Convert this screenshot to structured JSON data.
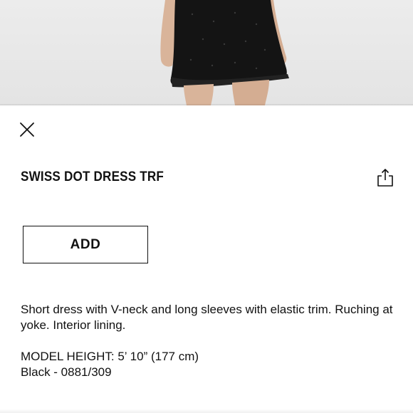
{
  "product": {
    "title": "SWISS DOT DRESS TRF",
    "description": "Short dress with V-neck and long sleeves with elastic trim. Ruching at yoke. Interior lining.",
    "model_height": "MODEL HEIGHT: 5’ 10” (177 cm)",
    "color_ref": "Black - 0881/309"
  },
  "actions": {
    "add_label": "ADD"
  },
  "icons": {
    "close": "close-icon",
    "share": "share-icon"
  },
  "colors": {
    "text": "#111111",
    "background": "#ffffff",
    "photo_background": "#e8e8e8",
    "dress": "#141414"
  }
}
